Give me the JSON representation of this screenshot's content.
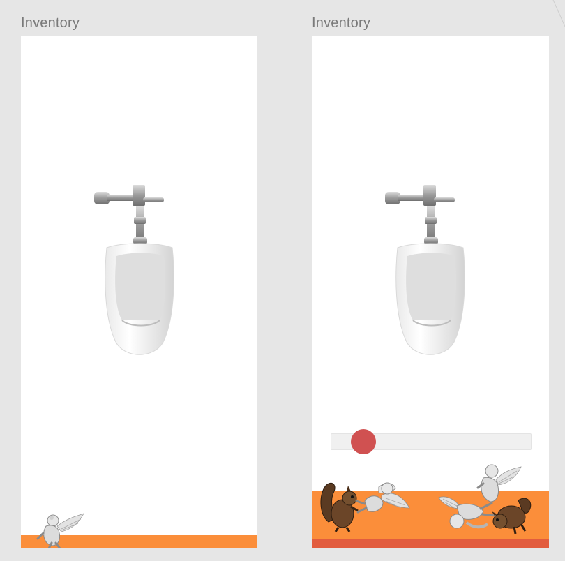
{
  "frames": [
    {
      "label": "Inventory"
    },
    {
      "label": "Inventory",
      "slider": {
        "value": 0.08
      }
    }
  ],
  "colors": {
    "background": "#e6e6e6",
    "panel": "#ffffff",
    "label_text": "#7a7a7a",
    "inventory_bar": "#fb8e3a",
    "inventory_bar_edge": "#e25c3e",
    "slider_track": "#f0f0f0",
    "slider_thumb": "#d05151"
  },
  "icons": {
    "fixture": "urinal-icon",
    "figurine": "cherub-statue-icon",
    "animal": "squirrel-icon"
  }
}
